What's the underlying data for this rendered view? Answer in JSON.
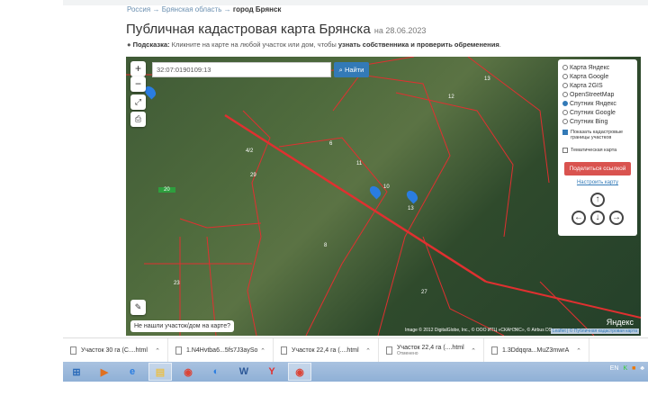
{
  "breadcrumb": {
    "items": [
      "Россия",
      "Брянская область"
    ],
    "current": "город Брянск",
    "sep": "→"
  },
  "title": "Публичная кадастровая карта Брянска",
  "date": "на 28.06.2023",
  "hint": {
    "label": "Подсказка:",
    "text": "Кликните на карте на любой участок или дом, чтобы",
    "bold": "узнать собственника и проверить обременения",
    "end": "."
  },
  "map": {
    "search_value": "32:07:0190109:13",
    "find_label": "Найти",
    "zoom_in": "+",
    "zoom_out": "−",
    "layers": [
      {
        "label": "Карта Яндекс",
        "selected": false
      },
      {
        "label": "Карта Google",
        "selected": false
      },
      {
        "label": "Карта 2GIS",
        "selected": false
      },
      {
        "label": "OpenStreetMap",
        "selected": false
      },
      {
        "label": "Спутник Яндекс",
        "selected": true
      },
      {
        "label": "Спутник Google",
        "selected": false
      },
      {
        "label": "Спутник Bing",
        "selected": false
      }
    ],
    "show_borders": {
      "label": "Показать кадастровые границы участков",
      "checked": true
    },
    "thematic": {
      "label": "Тематическая карта",
      "checked": false
    },
    "share_label": "Поделиться ссылкой",
    "configure_label": "Настроить карту",
    "parcel_labels": [
      "6",
      "11",
      "10",
      "13",
      "8",
      "27",
      "29",
      "4/2",
      "20",
      "12",
      "13",
      "23"
    ],
    "not_found": "Не нашли участок/дом на карте?",
    "attribution": "Image © 2012 DigitalGlobe, Inc., © ООО ИТЦ «СКАНЭКС», © Airbus DS",
    "yandex": "Яндекс",
    "pkk_link": "Leaflet | © Публичная кадастровая карта"
  },
  "downloads": [
    {
      "name": "Участок 30 га (С....html"
    },
    {
      "name": "1.N4Hvtba6...5fs7J3aySo"
    },
    {
      "name": "Участок 22,4 га (....html"
    },
    {
      "name": "Участок 22,4 га (....html",
      "status": "Отменено"
    },
    {
      "name": "1.3Ddqqra...MuZ3mwrA"
    }
  ],
  "taskbar": {
    "lang": "EN"
  },
  "colors": {
    "accent": "#337ab7",
    "share": "#d9534f",
    "parcel_border": "#e03030"
  }
}
